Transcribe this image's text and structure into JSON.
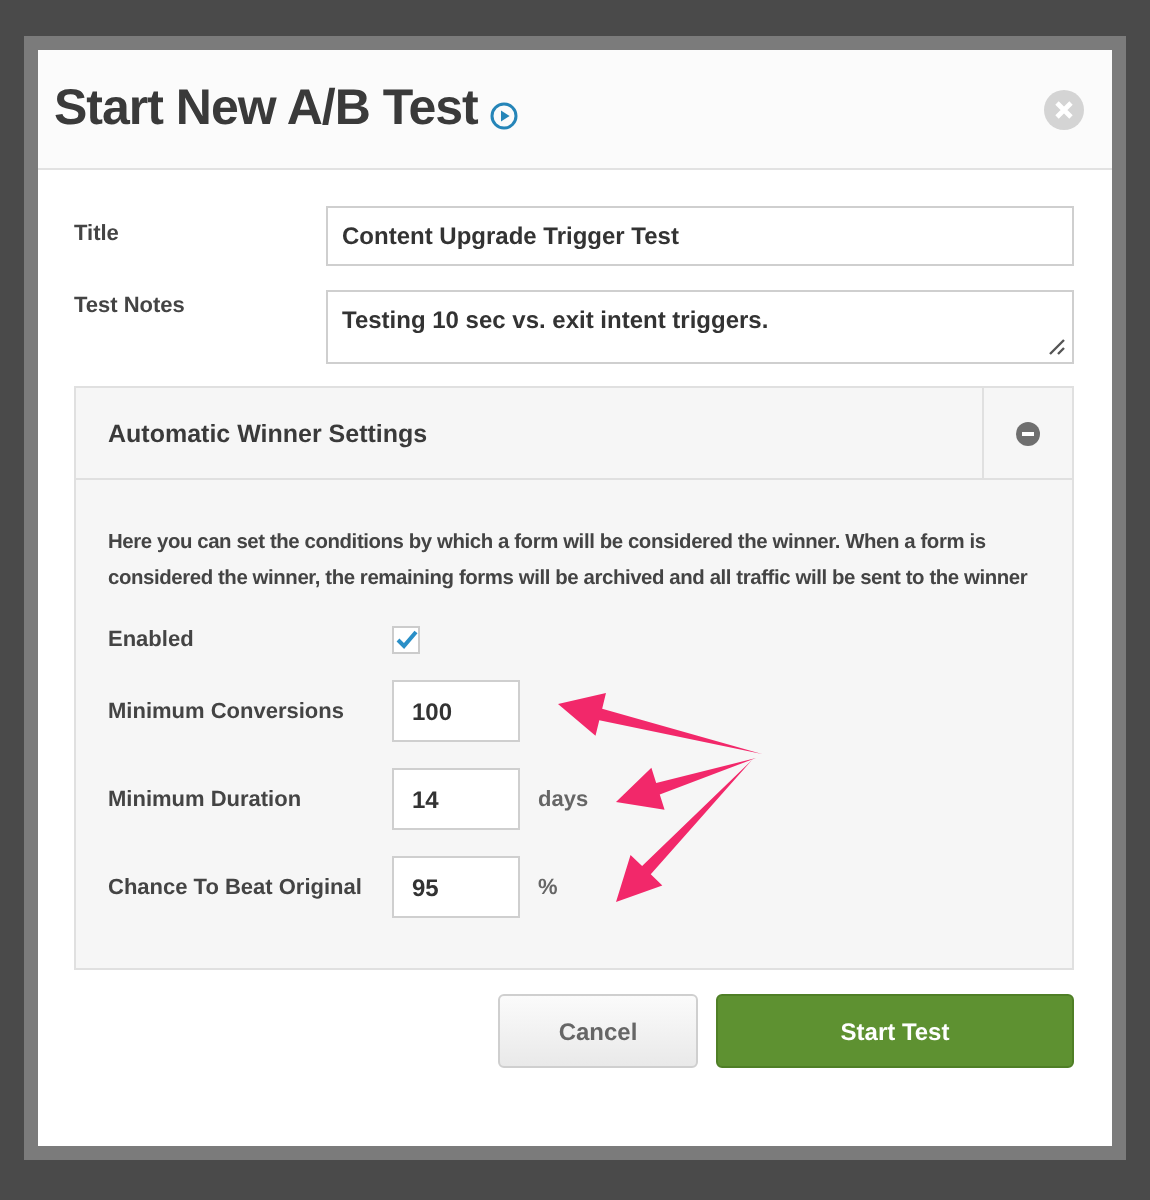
{
  "dialog": {
    "title": "Start New A/B Test",
    "fields": [
      {
        "label": "Title",
        "kind": "input",
        "value": "Content Upgrade Trigger Test"
      },
      {
        "label": "Test Notes",
        "kind": "textarea",
        "value": "Testing 10 sec vs. exit intent triggers."
      }
    ],
    "panel": {
      "title": "Automatic Winner Settings",
      "expanded": true,
      "description": "Here you can set the conditions by which a form will be considered the winner. When a form is considered the winner, the remaining forms will be archived and all traffic will be sent to the winner",
      "settings": [
        {
          "label": "Enabled",
          "kind": "checkbox",
          "checked": true
        },
        {
          "label": "Minimum Conversions",
          "kind": "number",
          "value": "100"
        },
        {
          "label": "Minimum Duration",
          "kind": "number",
          "value": "14",
          "unit": "days"
        },
        {
          "label": "Chance To Beat Original",
          "kind": "number",
          "value": "95",
          "unit": "%"
        }
      ]
    },
    "buttons": [
      {
        "label": "Cancel",
        "kind": "secondary"
      },
      {
        "label": "Start Test",
        "kind": "primary"
      }
    ]
  }
}
